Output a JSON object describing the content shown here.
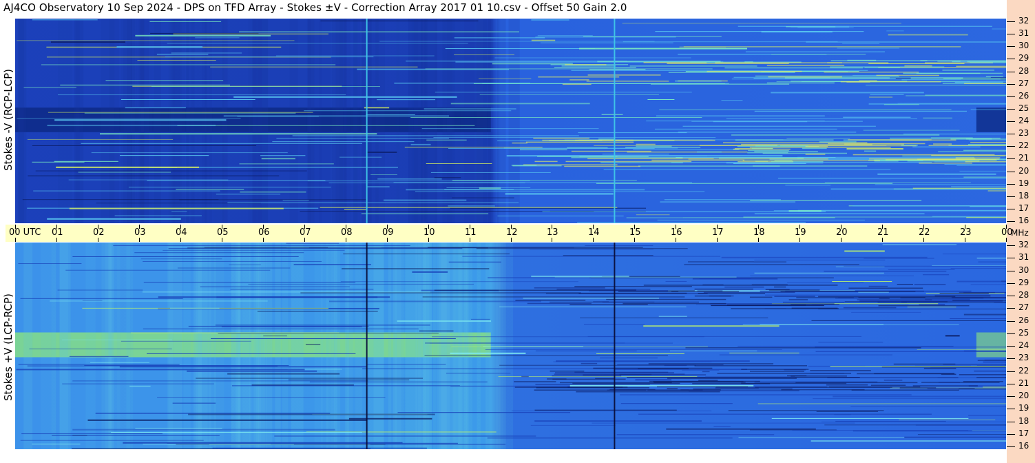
{
  "title": "AJ4CO Observatory  10 Sep 2024  -  DPS on TFD Array  -  Stokes ±V  -  Correction Array 2017 01 10.csv  -  Offset 50  Gain 2.0",
  "top_panel": {
    "ylabel": "Stokes -V (RCP-LCP)"
  },
  "bottom_panel": {
    "ylabel": "Stokes +V (LCP-RCP)"
  },
  "time_axis": {
    "labels": [
      "00 UTC",
      "01",
      "02",
      "03",
      "04",
      "05",
      "06",
      "07",
      "08",
      "09",
      "10",
      "11",
      "12",
      "13",
      "14",
      "15",
      "16",
      "17",
      "18",
      "19",
      "20",
      "21",
      "22",
      "23",
      "00"
    ]
  },
  "freq_axis": {
    "unit": "MHz",
    "labels": [
      "32",
      "31",
      "30",
      "29",
      "28",
      "27",
      "26",
      "25",
      "24",
      "23",
      "22",
      "21",
      "20",
      "19",
      "18",
      "17",
      "16"
    ]
  },
  "colors": {
    "background": "#ffffff",
    "time_bar": "#ffffc4",
    "freq_strip": "#fbd9c2",
    "spectrogram_base": "#2a64e0",
    "spectrogram_dark": "#0a1f6e",
    "spectrogram_light": "#7ee8c8",
    "spectrogram_hot": "#ffe23a"
  },
  "chart_data": {
    "type": "heatmap",
    "title": "AJ4CO Observatory  10 Sep 2024  -  DPS on TFD Array  -  Stokes ±V  -  Correction Array 2017 01 10.csv  -  Offset 50  Gain 2.0",
    "panels": [
      {
        "name": "Stokes -V (RCP-LCP)",
        "xlim_utc_hours": [
          0,
          24
        ],
        "ylim_mhz": [
          16,
          32
        ]
      },
      {
        "name": "Stokes +V (LCP-RCP)",
        "xlim_utc_hours": [
          0,
          24
        ],
        "ylim_mhz": [
          16,
          32
        ]
      }
    ],
    "x_ticks_utc": [
      "00 UTC",
      "01",
      "02",
      "03",
      "04",
      "05",
      "06",
      "07",
      "08",
      "09",
      "10",
      "11",
      "12",
      "13",
      "14",
      "15",
      "16",
      "17",
      "18",
      "19",
      "20",
      "21",
      "22",
      "23",
      "00"
    ],
    "y_ticks_mhz": [
      32,
      31,
      30,
      29,
      28,
      27,
      26,
      25,
      24,
      23,
      22,
      21,
      20,
      19,
      18,
      17,
      16
    ],
    "vertical_markers_utc": [
      8.5,
      14.5
    ]
  }
}
